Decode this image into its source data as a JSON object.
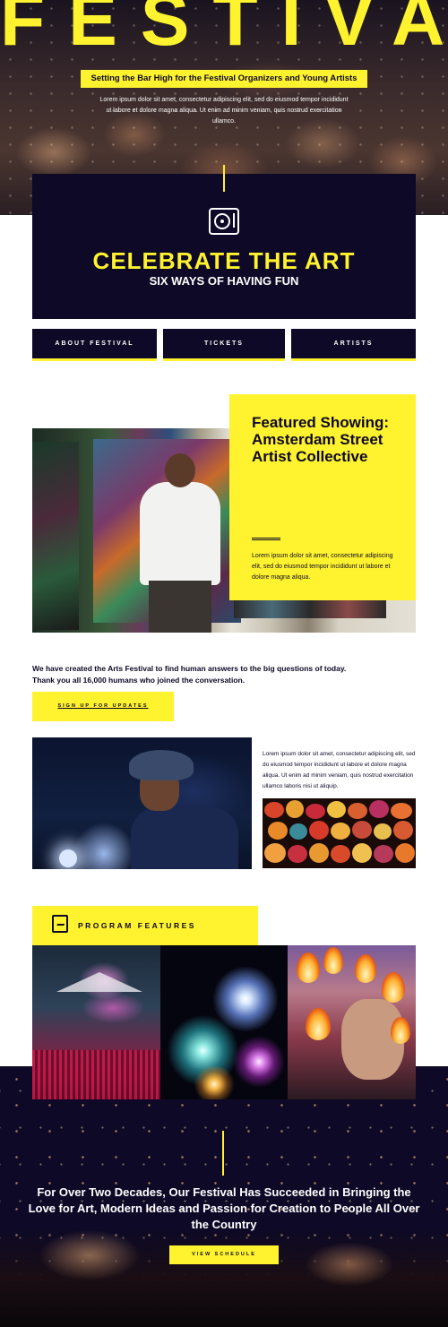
{
  "hero": {
    "title": "FESTIVAL",
    "tagline": "Setting the Bar High for the Festival Organizers and Young Artists",
    "body": "Lorem ipsum dolor sit amet, consectetur adipiscing elit, sed do eiusmod tempor incididunt ut labore et dolore magna aliqua. Ut enim ad minim veniam, quis nostrud exercitation ullamco."
  },
  "celebrate": {
    "icon": "turntable-icon",
    "title": "CELEBRATE THE ART",
    "subtitle": "SIX WAYS OF HAVING FUN"
  },
  "nav": {
    "items": [
      {
        "label": "ABOUT FESTIVAL"
      },
      {
        "label": "TICKETS"
      },
      {
        "label": "ARTISTS"
      }
    ]
  },
  "featured": {
    "title": "Featured Showing: Amsterdam Street Artist Collective",
    "text": "Lorem ipsum dolor sit amet, consectetur adipiscing elit, sed do eiusmod tempor incididunt ut labore et dolore magna aliqua."
  },
  "intro": {
    "line1": "We have created the Arts Festival to find human answers to the big questions of today.",
    "line2": "Thank you all 16,000 humans who joined the conversation.",
    "signup_label": "SIGN UP FOR UPDATES"
  },
  "singer_section": {
    "text": "Lorem ipsum dolor sit amet, consectetur adipiscing elit, sed do eiusmod tempor incididunt ut labore et dolore magna aliqua. Ut enim ad minim veniam, quis nostrud exercitation ullamco laboris nisi ut aliquip."
  },
  "program": {
    "icon": "gallery-icon",
    "label": "PROGRAM FEATURES"
  },
  "bottom": {
    "heading": "For Over Two Decades, Our Festival Has Succeeded in Bringing the Love for Art, Modern Ideas and Passion for Creation to People All Over the Country",
    "button_label": "VIEW SCHEDULE"
  },
  "colors": {
    "accent": "#fff22e",
    "navy": "#0d0926"
  }
}
